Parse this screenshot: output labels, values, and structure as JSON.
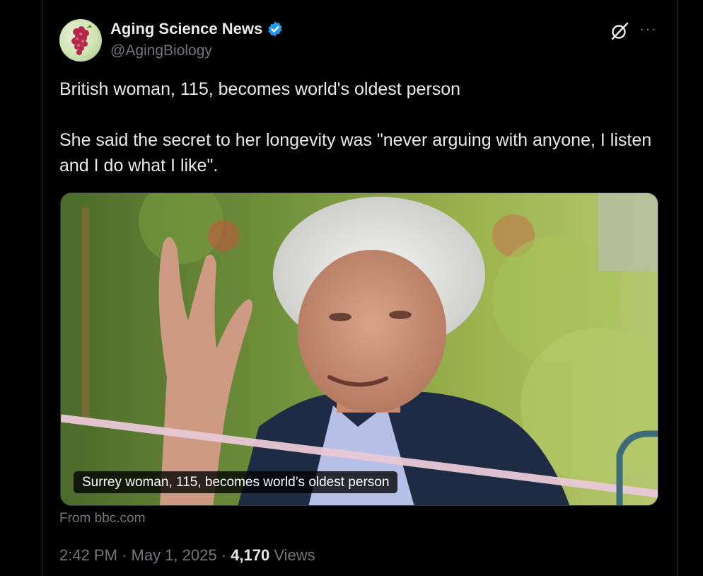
{
  "author": {
    "name": "Aging Science News",
    "handle": "@AgingBiology",
    "verified_color": "#1d9bf0"
  },
  "post": {
    "line1": "British woman, 115, becomes world's oldest person",
    "line2": "She said the secret to her longevity was \"never arguing with anyone, I listen and I do what I like\".",
    "media_caption": "Surrey woman, 115, becomes world’s oldest person",
    "source": "From bbc.com",
    "time": "2:42 PM",
    "separator": "·",
    "date": "May 1, 2025",
    "views_count": "4,170",
    "views_label": "Views"
  },
  "icons": {
    "grok": "grok-icon",
    "more": "more-icon",
    "verified": "verified-badge-icon"
  },
  "more_glyph": "···"
}
